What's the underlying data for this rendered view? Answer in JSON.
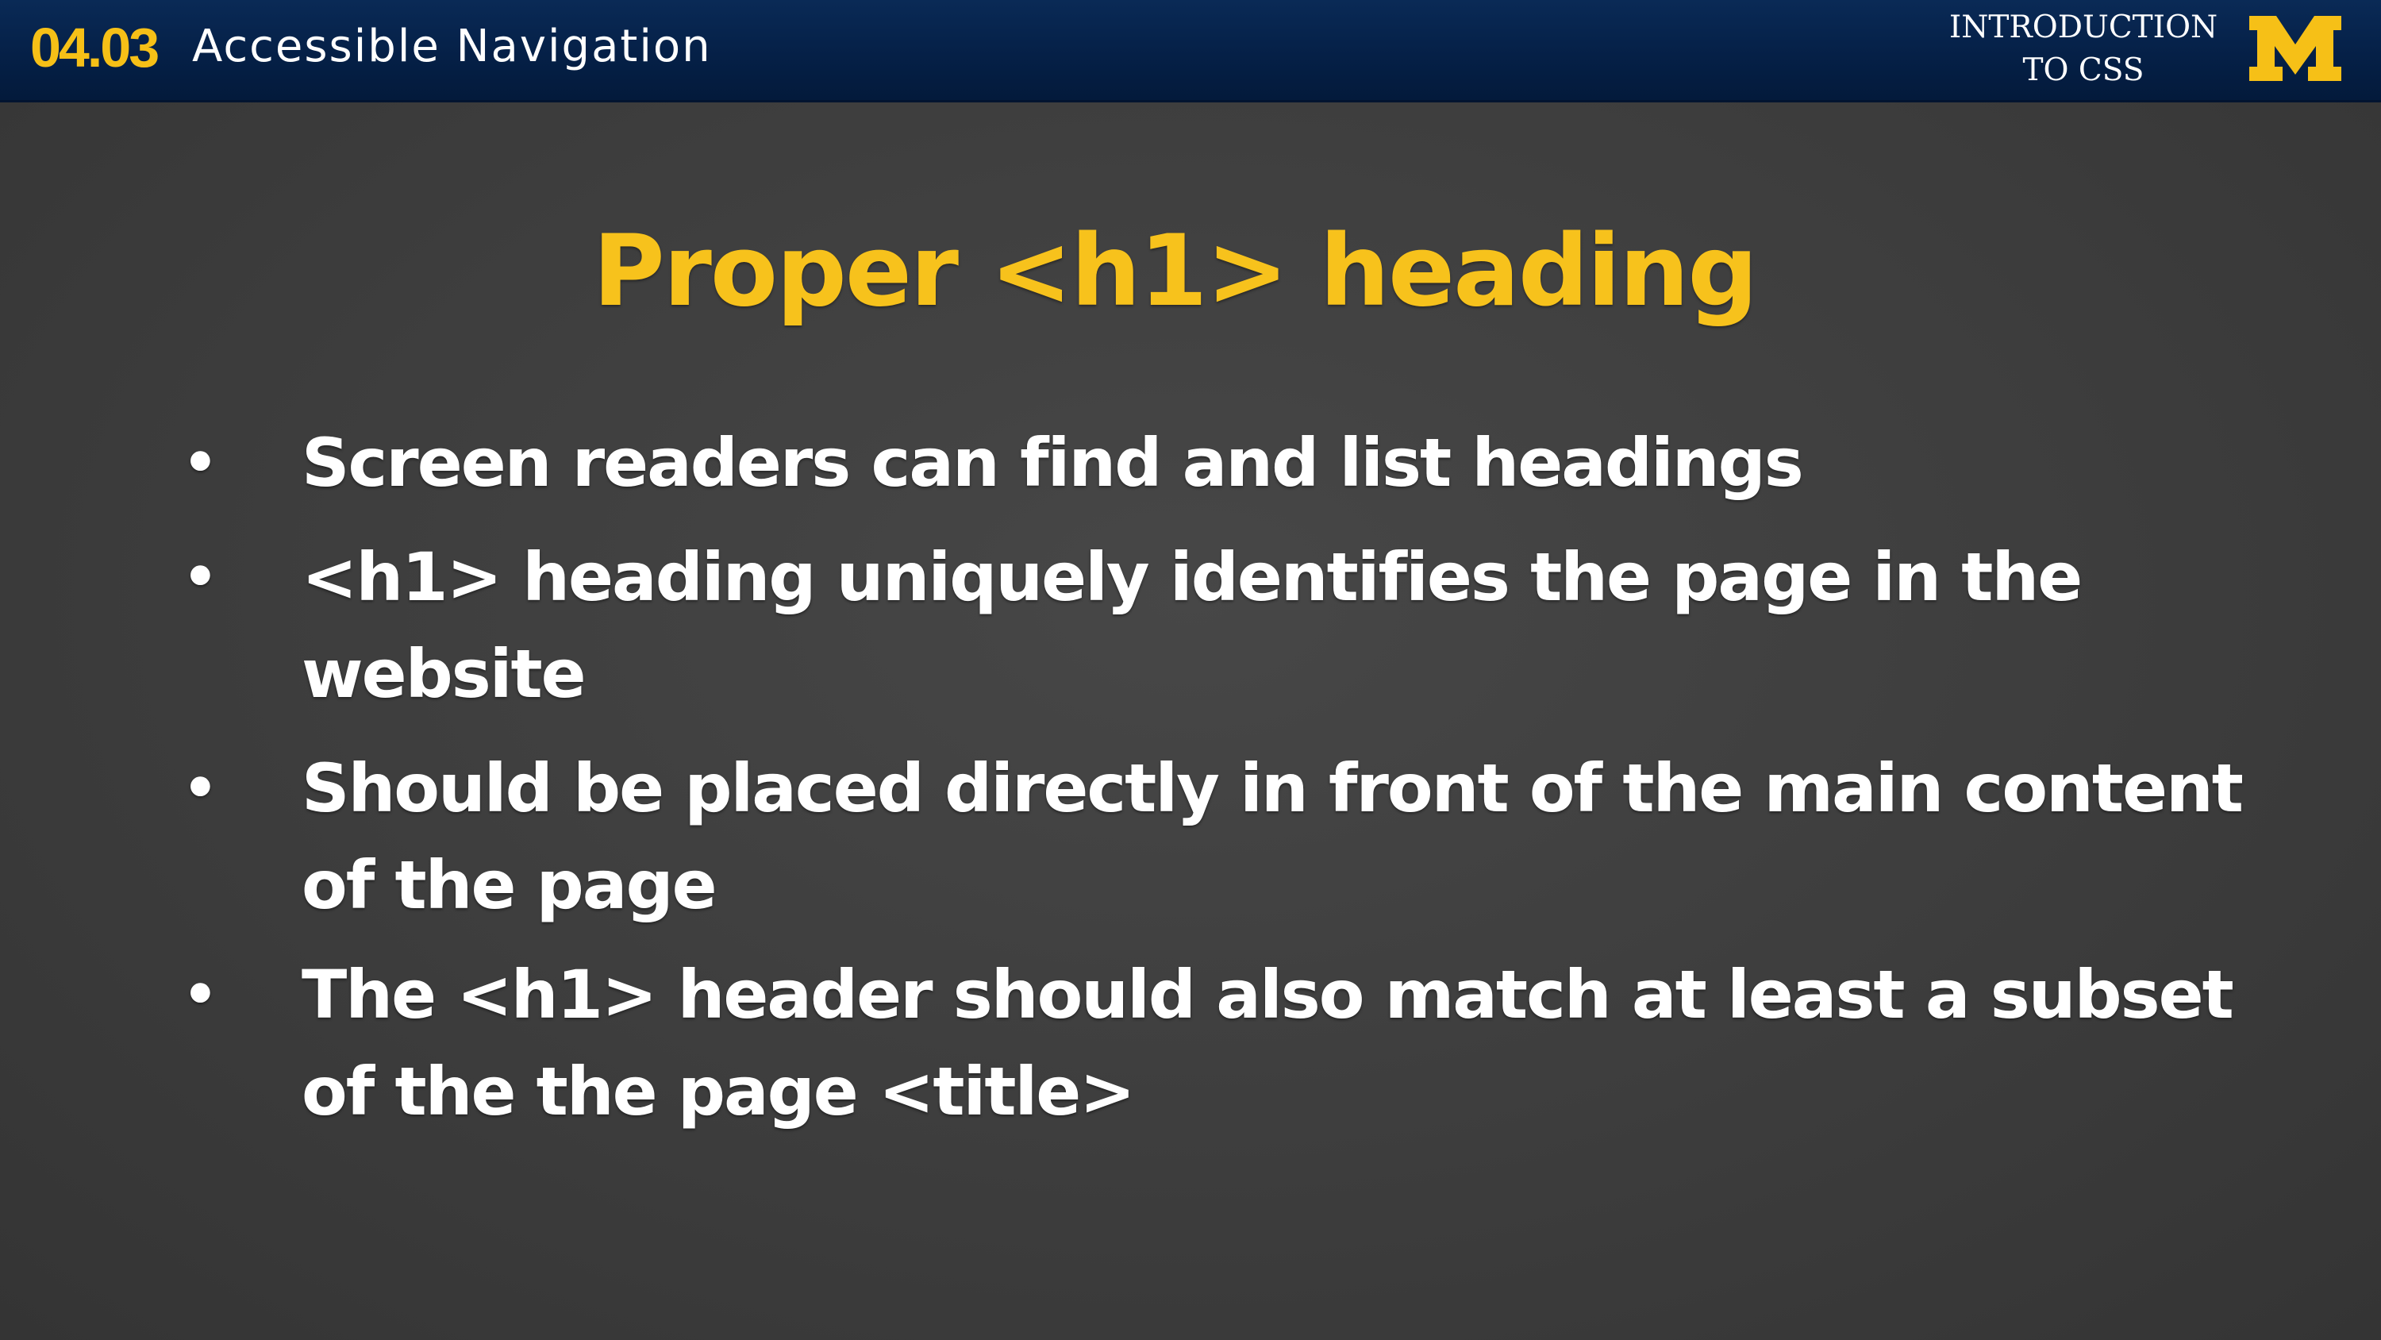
{
  "header": {
    "lesson_number": "04.03",
    "lesson_title": "Accessible Navigation",
    "course_title_line1": "INTRODUCTION",
    "course_title_line2": "TO CSS",
    "logo_icon": "university-of-michigan-block-m-logo",
    "brand_navy": "#052047",
    "brand_maize": "#f6c017"
  },
  "slide": {
    "heading": "Proper <h1> heading",
    "bullets": [
      "Screen readers can find and list headings",
      "<h1> heading uniquely identifies the page in the website",
      "Should be placed directly in front of the main content of the page",
      "The <h1> header should also match at least a subset of the the page <title>"
    ],
    "heading_color": "#f7c21c",
    "text_color": "#ffffff",
    "background_color": "#3e3e3e"
  }
}
